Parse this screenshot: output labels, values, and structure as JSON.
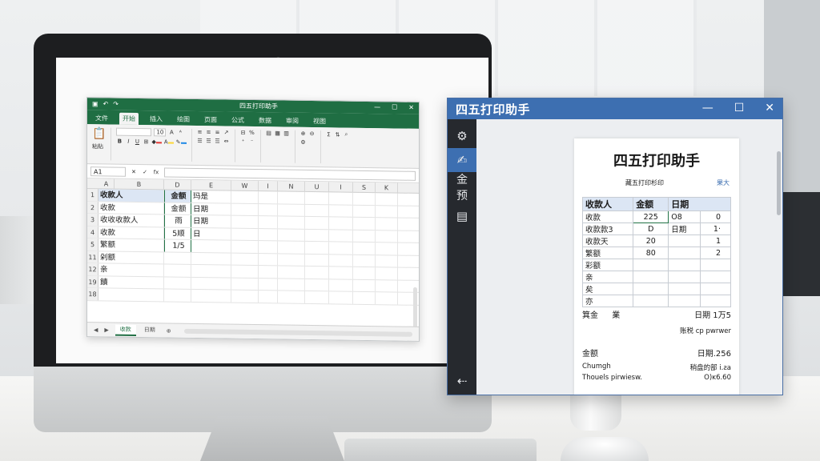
{
  "excel": {
    "title": "四五打印助手",
    "tabs": [
      "文件",
      "开始",
      "插入",
      "绘图",
      "页面",
      "公式",
      "数据",
      "审阅",
      "视图"
    ],
    "active_tab_index": 1,
    "ribbon": {
      "font_size": "10",
      "clipboard_label": "粘贴",
      "accent_colors": [
        "#e53935",
        "#fdd835",
        "#1e88e5"
      ]
    },
    "name_box": "A1",
    "formula_value": "",
    "columns": [
      "A",
      "B",
      "D",
      "E",
      "W",
      "I",
      "N",
      "U",
      "I",
      "S",
      "K"
    ],
    "rows": [
      {
        "num": "1",
        "a": "收款人",
        "d": "金额",
        "e": "玛是",
        "header": true
      },
      {
        "num": "2",
        "a": "收款",
        "d": "金额",
        "e": "日期"
      },
      {
        "num": "3",
        "a": "收收收款人",
        "d": "雨",
        "e": "日期"
      },
      {
        "num": "4",
        "a": "收款",
        "d": "5顺",
        "e": "日"
      },
      {
        "num": "5",
        "a": "繁额",
        "d": "1/5",
        "e": ""
      },
      {
        "num": "11",
        "a": "剁额",
        "d": "",
        "e": ""
      },
      {
        "num": "12",
        "a": "亲",
        "d": "",
        "e": ""
      },
      {
        "num": "19",
        "a": "饋",
        "d": "",
        "e": ""
      },
      {
        "num": "18",
        "a": "",
        "d": "",
        "e": ""
      }
    ],
    "sheet_tabs": [
      "收款",
      "日期"
    ],
    "active_sheet_index": 0,
    "brand_color": "#1f6e43"
  },
  "printer": {
    "window_title": "四五打印助手",
    "controls": {
      "minimize": "—",
      "maximize": "☐",
      "close": "✕"
    },
    "sidebar": {
      "label_top": "金",
      "label_bottom": "预"
    },
    "paper": {
      "title": "四五打印助手",
      "subtitle_left": "藏五打印杉印",
      "subtitle_right": "果大",
      "table_head": [
        "收款人",
        "金额",
        "日期"
      ],
      "table_rows": [
        [
          "收款",
          "225",
          "Ο8",
          "0"
        ],
        [
          "收款款3",
          "D",
          "日期",
          "1·"
        ],
        [
          "收款天",
          "20",
          "",
          "1"
        ],
        [
          "繁额",
          "80",
          "",
          "2"
        ],
        [
          "彩额",
          "",
          "",
          ""
        ],
        [
          "亲",
          "",
          "",
          ""
        ],
        [
          "矣",
          "",
          "",
          ""
        ],
        [
          "亦",
          "",
          "",
          ""
        ]
      ],
      "footer1_left": "箕金",
      "footer1_mid": "業",
      "footer1_right": "日期 1万5",
      "footer2_right": "账税 cp pwrwer",
      "footer3_left": "金额",
      "footer3_right": "日期.256",
      "footer4_left": "Chumgh",
      "footer4_right": "稍盘的部 i.ƨa",
      "footer5_left": "Thouels pirwiesw.",
      "footer5_right": "Ο)ĸ6.60"
    },
    "accent_color": "#3d6fb1"
  }
}
